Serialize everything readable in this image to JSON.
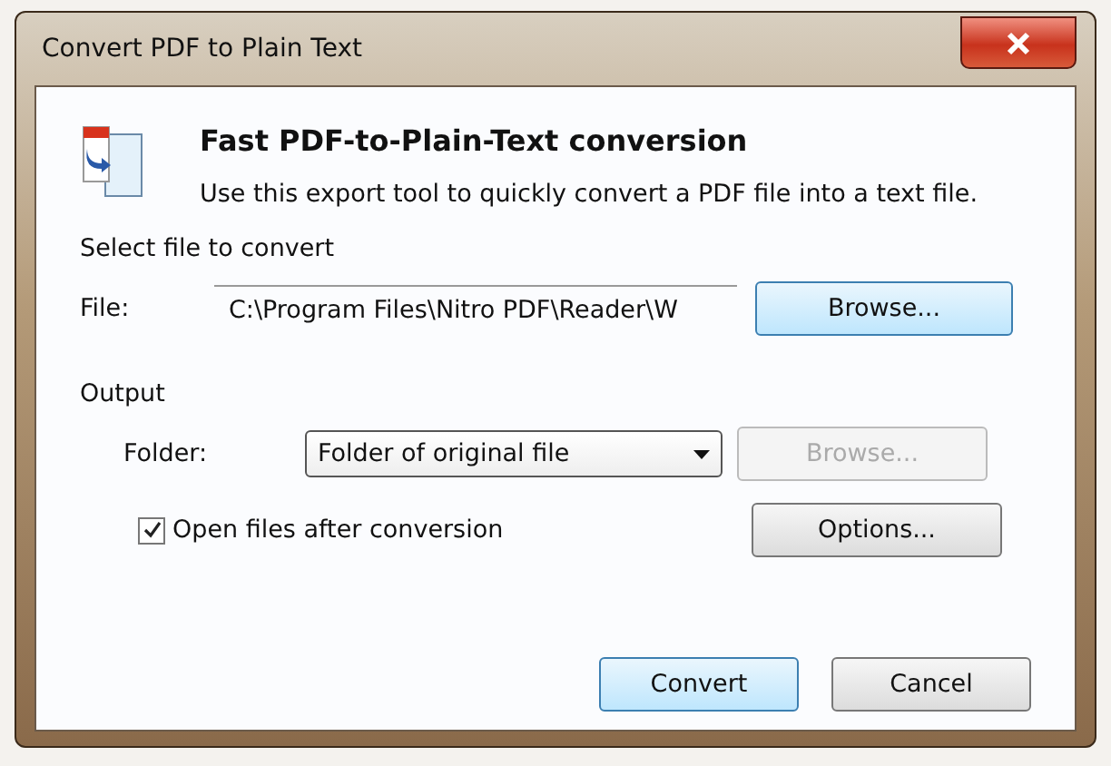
{
  "window": {
    "title": "Convert PDF to Plain Text"
  },
  "header": {
    "title": "Fast PDF-to-Plain-Text conversion",
    "description": "Use this export tool to quickly convert a PDF file into a text file."
  },
  "source": {
    "heading": "Select file to convert",
    "file_label": "File:",
    "file_value": "C:\\Program Files\\Nitro PDF\\Reader\\W",
    "browse": {
      "label": "Browse...",
      "disabled": false,
      "highlighted": true
    }
  },
  "output": {
    "heading": "Output",
    "folder_label": "Folder:",
    "folder_value": "Folder of original file",
    "browse": {
      "label": "Browse...",
      "disabled": true,
      "highlighted": false
    },
    "open_after": {
      "label": "Open files after conversion",
      "checked": true
    },
    "options": {
      "label": "Options...",
      "disabled": false,
      "highlighted": false
    }
  },
  "buttons": [
    {
      "label": "Convert",
      "disabled": false,
      "highlighted": true
    },
    {
      "label": "Cancel",
      "disabled": false,
      "highlighted": false
    }
  ]
}
